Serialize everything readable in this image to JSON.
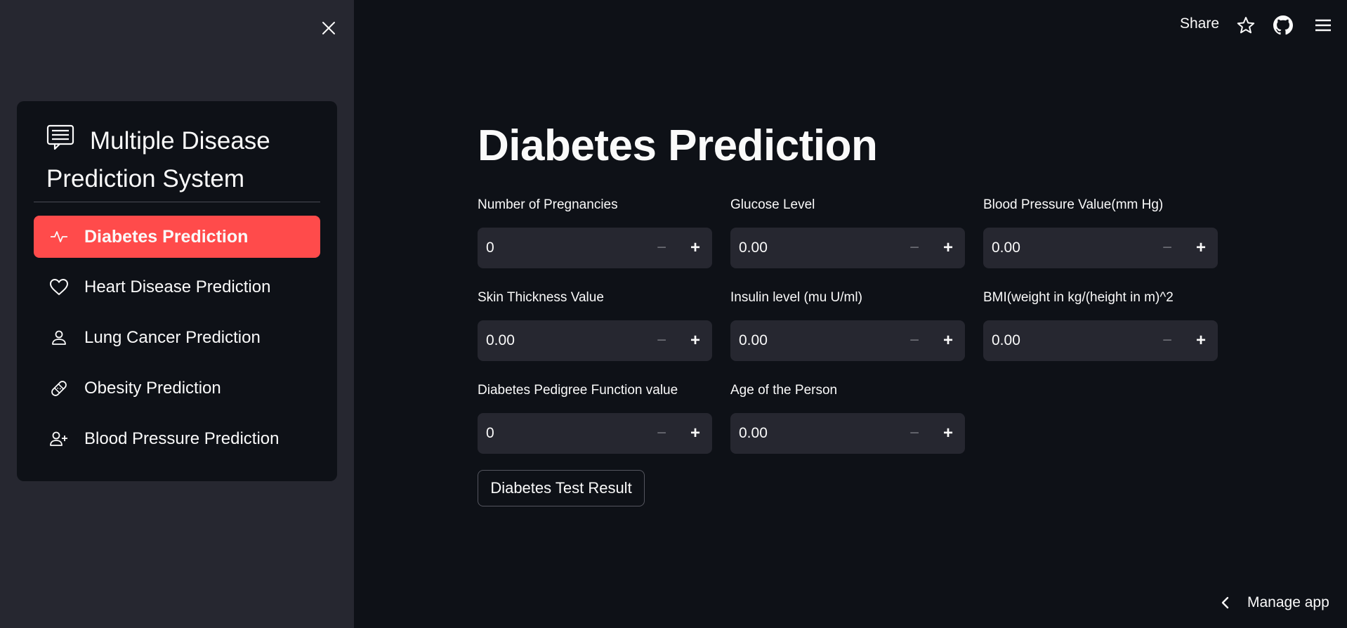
{
  "sidebar": {
    "menu_title": "Multiple Disease Prediction System",
    "items": [
      {
        "label": "Diabetes Prediction",
        "icon": "activity-icon",
        "active": true
      },
      {
        "label": "Heart Disease Prediction",
        "icon": "heart-icon",
        "active": false
      },
      {
        "label": "Lung Cancer Prediction",
        "icon": "person-icon",
        "active": false
      },
      {
        "label": "Obesity Prediction",
        "icon": "bandage-icon",
        "active": false
      },
      {
        "label": "Blood Pressure Prediction",
        "icon": "person-plus-icon",
        "active": false
      }
    ],
    "accent_color": "#ff4b4b"
  },
  "topbar": {
    "share_label": "Share",
    "icons": [
      "star-icon",
      "github-icon",
      "hamburger-menu-icon"
    ]
  },
  "main": {
    "title": "Diabetes Prediction",
    "fields": [
      {
        "label": "Number of Pregnancies",
        "value": "0"
      },
      {
        "label": "Glucose Level",
        "value": "0.00"
      },
      {
        "label": "Blood Pressure Value(mm Hg)",
        "value": "0.00"
      },
      {
        "label": "Skin Thickness Value",
        "value": "0.00"
      },
      {
        "label": "Insulin level (mu U/ml)",
        "value": "0.00"
      },
      {
        "label": "BMI(weight in kg/(height in m)^2",
        "value": "0.00"
      },
      {
        "label": "Diabetes Pedigree Function value",
        "value": "0"
      },
      {
        "label": "Age of the Person",
        "value": "0.00"
      }
    ],
    "stepper_minus": "−",
    "stepper_plus": "+",
    "submit_label": "Diabetes Test Result"
  },
  "footer": {
    "manage_label": "Manage app"
  },
  "colors": {
    "background": "#0e1117",
    "sidebar_bg": "#262730",
    "input_bg": "#262730"
  }
}
